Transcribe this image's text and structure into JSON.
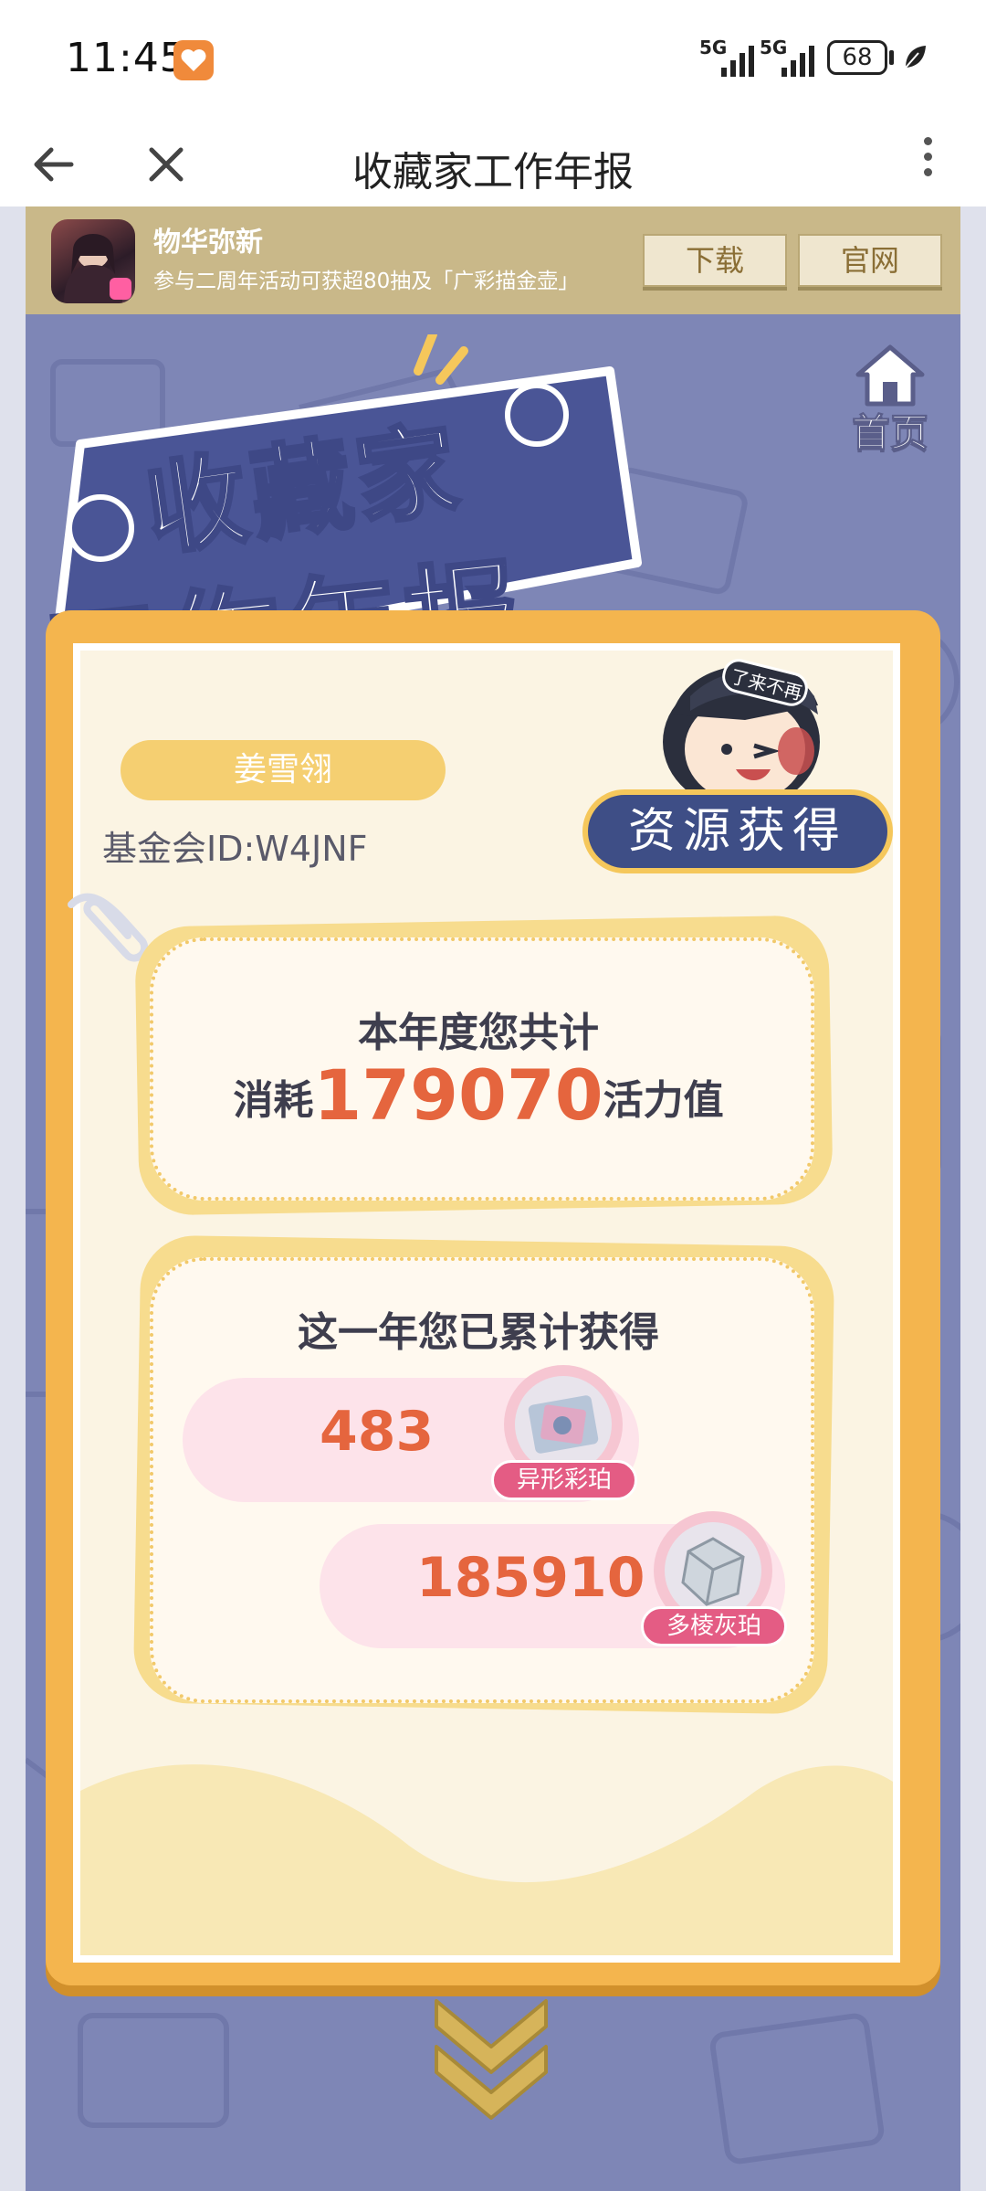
{
  "status": {
    "time": "11:45",
    "signal1": "5G",
    "signal2": "5G",
    "battery": "68"
  },
  "nav": {
    "title": "收藏家工作年报"
  },
  "banner": {
    "app_name": "物华弥新",
    "description": "参与二周年活动可获超80抽及「广彩描金壶」",
    "download_label": "下载",
    "website_label": "官网"
  },
  "home": {
    "label": "首页"
  },
  "logo": {
    "line1": "收藏家",
    "line2": "工作年报"
  },
  "profile": {
    "name": "姜雪翎",
    "fund_id": "基金会ID:W4JNF"
  },
  "section_tag": "资源获得",
  "hat_text": "了来不再",
  "consumption": {
    "line1": "本年度您共计",
    "prefix": "消耗",
    "value": "179070",
    "suffix": "活力值"
  },
  "obtained": {
    "title": "这一年您已累计获得",
    "items": [
      {
        "value": "483",
        "label": "异形彩珀",
        "icon": "colored-amber-icon"
      },
      {
        "value": "185910",
        "label": "多棱灰珀",
        "icon": "gray-amber-icon"
      }
    ]
  },
  "colors": {
    "page_bg": "#7e86b6",
    "card_orange": "#f4b54e",
    "accent_number": "#e5653e",
    "tag_navy": "#3e4e86",
    "pill_pink": "#fde3ea"
  }
}
